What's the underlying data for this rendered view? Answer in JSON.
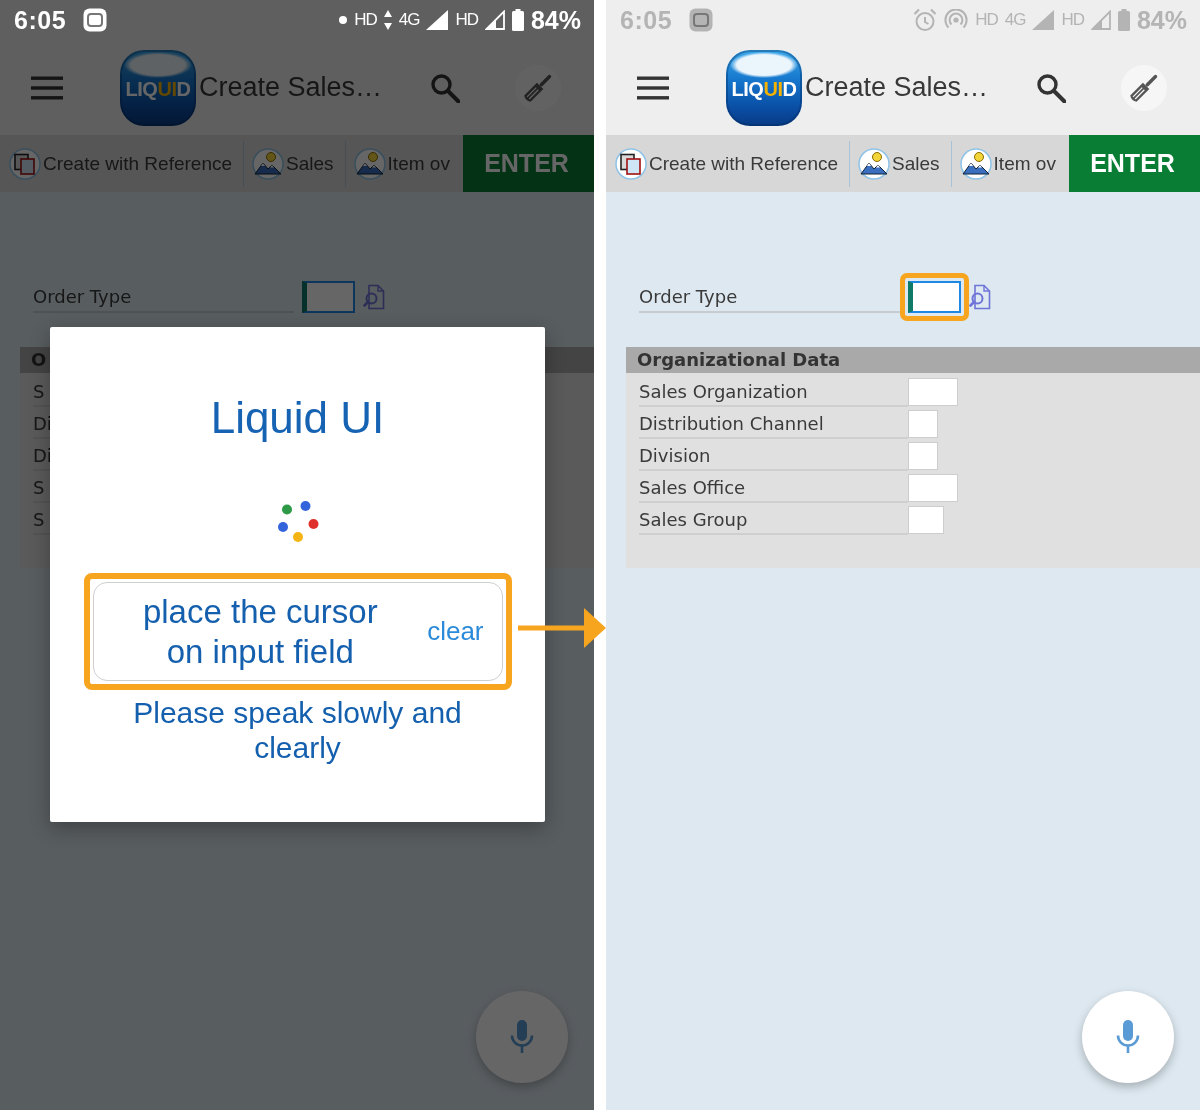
{
  "screens": [
    {
      "dimmed": true,
      "status_bar": {
        "time": "6:05",
        "items": [
          {
            "kind": "dot"
          },
          {
            "kind": "text",
            "text": "HD"
          },
          {
            "kind": "arrows"
          },
          {
            "kind": "text",
            "text": "4G"
          },
          {
            "kind": "signal"
          },
          {
            "kind": "text",
            "text": "HD"
          },
          {
            "kind": "signal_weak"
          },
          {
            "kind": "battery"
          },
          {
            "kind": "percent",
            "text": "84%"
          }
        ]
      },
      "app_bar": {
        "logo": [
          {
            "text": "LIQ",
            "accent": false
          },
          {
            "text": "UI",
            "accent": true
          },
          {
            "text": "D",
            "accent": false
          }
        ],
        "title": "Create Sales…"
      },
      "toolbar": {
        "items": [
          {
            "label": "Create with Reference",
            "kind": "reference"
          },
          {
            "label": "Sales",
            "kind": "screen"
          },
          {
            "label": "Item ov",
            "kind": "screen"
          }
        ],
        "enter": "ENTER"
      },
      "order_type": {
        "label": "Order Type",
        "focused": true,
        "highlighted": false
      },
      "group": {
        "title": "O",
        "rows": [
          {
            "label": "S"
          },
          {
            "label": "Di"
          },
          {
            "label": "Di"
          },
          {
            "label": "S"
          },
          {
            "label": "S"
          }
        ]
      },
      "dialog": {
        "title": "Liquid UI",
        "transcript": "place the cursor on input field",
        "clear": "clear",
        "highlighted": true,
        "hint": "Please speak slowly and clearly"
      }
    },
    {
      "dimmed": false,
      "status_bar": {
        "time": "6:05",
        "items": [
          {
            "kind": "alarm"
          },
          {
            "kind": "hotspot"
          },
          {
            "kind": "text",
            "text": "HD"
          },
          {
            "kind": "text",
            "text": "4G"
          },
          {
            "kind": "signal"
          },
          {
            "kind": "text",
            "text": "HD"
          },
          {
            "kind": "signal_weak"
          },
          {
            "kind": "battery"
          },
          {
            "kind": "percent",
            "text": "84%"
          }
        ]
      },
      "app_bar": {
        "logo": [
          {
            "text": "LIQ",
            "accent": false
          },
          {
            "text": "UI",
            "accent": true
          },
          {
            "text": "D",
            "accent": false
          }
        ],
        "title": "Create Sales…"
      },
      "toolbar": {
        "items": [
          {
            "label": "Create with Reference",
            "kind": "reference"
          },
          {
            "label": "Sales",
            "kind": "screen"
          },
          {
            "label": "Item ov",
            "kind": "screen"
          }
        ],
        "enter": "ENTER"
      },
      "order_type": {
        "label": "Order Type",
        "focused": true,
        "highlighted": true
      },
      "group": {
        "title": "Organizational Data",
        "rows": [
          {
            "label": "Sales Organization"
          },
          {
            "label": "Distribution Channel"
          },
          {
            "label": "Division"
          },
          {
            "label": "Sales Office"
          },
          {
            "label": "Sales Group"
          }
        ]
      }
    }
  ]
}
